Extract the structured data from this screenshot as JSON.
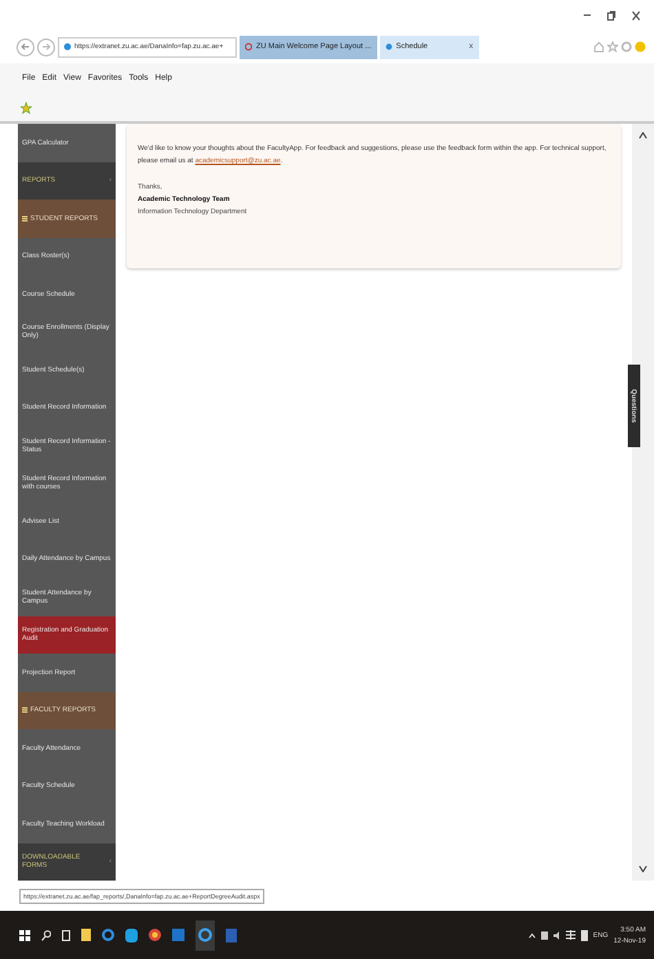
{
  "browser": {
    "address": "https://extranet.zu.ac.ae/DanaInfo=fap.zu.ac.ae+",
    "tabs": [
      {
        "label": "ZU Main Welcome Page Layout ...",
        "selected": false
      },
      {
        "label": "Schedule",
        "selected": true,
        "close": "x"
      }
    ],
    "menu": [
      "File",
      "Edit",
      "View",
      "Favorites",
      "Tools",
      "Help"
    ]
  },
  "sidebar": {
    "items": [
      {
        "kind": "link",
        "label": "GPA Calculator",
        "selected": false
      },
      {
        "kind": "group",
        "label": "REPORTS",
        "selected": false,
        "caret": "‹"
      },
      {
        "kind": "section",
        "label": "STUDENT REPORTS",
        "selected": false
      },
      {
        "kind": "link",
        "label": "Class Roster(s)",
        "selected": false
      },
      {
        "kind": "link",
        "label": "Course Schedule",
        "selected": false
      },
      {
        "kind": "link",
        "label": "Course Enrollments (Display Only)",
        "selected": false
      },
      {
        "kind": "link",
        "label": "Student Schedule(s)",
        "selected": false
      },
      {
        "kind": "link",
        "label": "Student Record Information",
        "selected": false
      },
      {
        "kind": "link",
        "label": "Student Record Information - Status",
        "selected": false
      },
      {
        "kind": "link",
        "label": "Student Record Information with courses",
        "selected": false
      },
      {
        "kind": "link",
        "label": "Advisee List",
        "selected": false
      },
      {
        "kind": "link",
        "label": "Daily Attendance by Campus",
        "selected": false
      },
      {
        "kind": "link",
        "label": "Student Attendance by Campus",
        "selected": false
      },
      {
        "kind": "link",
        "label": "Registration and Graduation Audit",
        "selected": true
      },
      {
        "kind": "link",
        "label": "Projection Report",
        "selected": false
      },
      {
        "kind": "section",
        "label": "FACULTY REPORTS",
        "selected": false
      },
      {
        "kind": "link",
        "label": "Faculty Attendance",
        "selected": false
      },
      {
        "kind": "link",
        "label": "Faculty Schedule",
        "selected": false
      },
      {
        "kind": "link",
        "label": "Faculty Teaching Workload",
        "selected": false
      },
      {
        "kind": "group",
        "label": "DOWNLOADABLE FORMS",
        "selected": false,
        "caret": "‹"
      }
    ]
  },
  "message": {
    "text": "We'd like to know your thoughts about the FacultyApp. For feedback and suggestions, please use the feedback form within the app. For technical support, please email us at",
    "email": "academicsupport@zu.ac.ae",
    "email_suffix": ".",
    "thanks": "Thanks,",
    "team": "Academic Technology Team",
    "department": "Information Technology Department"
  },
  "questions_tab": "Questions",
  "status_url": "https://extranet.zu.ac.ae/fap_reports/,DanaInfo=fap.zu.ac.ae+ReportDegreeAudit.aspx",
  "taskbar": {
    "language": "ENG",
    "time": "3:50 AM",
    "date": "12-Nov-19"
  }
}
